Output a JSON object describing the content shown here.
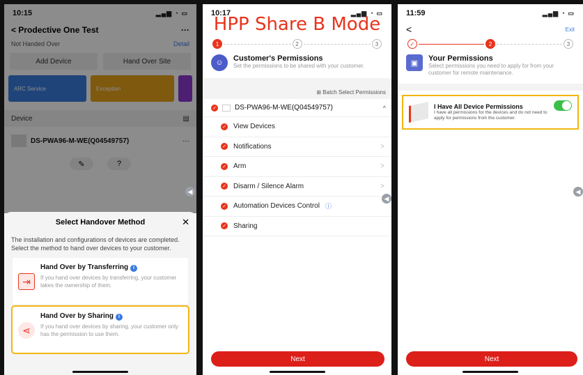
{
  "panel1": {
    "status_time": "10:15",
    "status_icons": "▂▄▆ ◔ ▭",
    "nav_title": "Prodective One Test",
    "nav_back": "<",
    "nav_more": "···",
    "handed_status": "Not Handed Over",
    "detail": "Detail",
    "add_device": "Add Device",
    "hand_over_site": "Hand Over Site",
    "card_arc": "ARC Service",
    "card_exception": "Exception",
    "device_header": "Device",
    "device_name": "DS-PWA96-M-WE(Q04549757)",
    "device_more": "···",
    "sheet": {
      "title": "Select Handover Method",
      "close": "✕",
      "description": "The installation and configurations of devices are completed. Select the method to hand over devices to your customer.",
      "options": [
        {
          "title": "Hand Over by Transferring",
          "desc": "If you hand over devices by transferring, your customer takes the ownership of them.",
          "icon": "transfer-icon"
        },
        {
          "title": "Hand Over by Sharing",
          "desc": "If you hand over devices by sharing, your customer only has the permission to use them.",
          "icon": "share-icon"
        }
      ]
    }
  },
  "panel2": {
    "status_time": "10:17",
    "overlay_title": "HPP Share B Mode",
    "steps": [
      "1",
      "2",
      "3"
    ],
    "title": "Customer's Permissions",
    "desc": "Set the permissions to be shared with your customer.",
    "batch": "Batch Select Permissions",
    "device": "DS-PWA96-M-WE(Q04549757)",
    "permissions": [
      {
        "label": "View Devices",
        "arrow": ""
      },
      {
        "label": "Notifications",
        "arrow": ">"
      },
      {
        "label": "Arm",
        "arrow": ">"
      },
      {
        "label": "Disarm / Silence Alarm",
        "arrow": ">"
      },
      {
        "label": "Automation Devices Control",
        "arrow": ""
      },
      {
        "label": "Sharing",
        "arrow": ""
      }
    ],
    "next": "Next"
  },
  "panel3": {
    "status_time": "11:59",
    "back": "<",
    "exit": "Exit",
    "steps": [
      "✓",
      "2",
      "3"
    ],
    "title": "Your Permissions",
    "desc": "Select permissions you need to apply for from your customer for remote maintenance.",
    "all_title": "I Have All Device Permissions",
    "all_desc": "I have all permissions for the devices and do not need to apply for permissions from the customer.",
    "toggle_on": true,
    "next": "Next"
  },
  "colors": {
    "accent": "#dd1f1a",
    "highlight": "#f2b50f",
    "toggle": "#3bbf4a",
    "link": "#3b7be0"
  }
}
